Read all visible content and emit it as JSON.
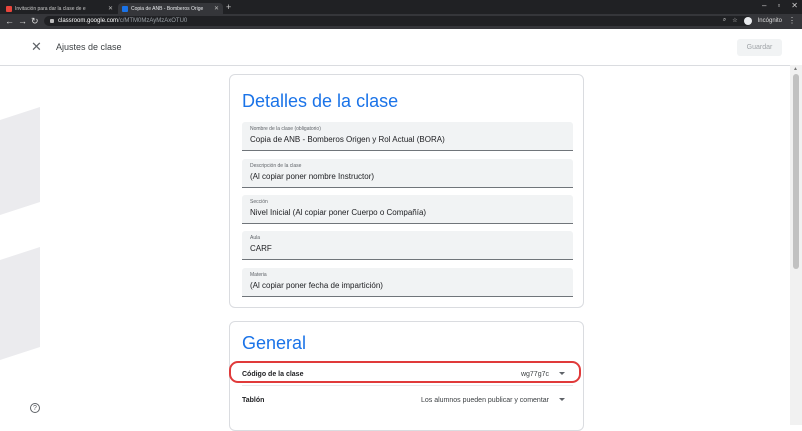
{
  "browser": {
    "tabs": [
      {
        "title": "Invitación para dar la clase de e",
        "favicon_color": "#e8453c"
      },
      {
        "title": "Copia de ANB - Bomberos Orige",
        "favicon_color": "#1a73e8"
      }
    ],
    "url_host": "classroom.google.com",
    "url_path": "/c/MTM0MzAyMzAxOTU0",
    "profile_label": "Incógnito"
  },
  "header": {
    "title": "Ajustes de clase",
    "save_label": "Guardar"
  },
  "details": {
    "heading": "Detalles de la clase",
    "fields": [
      {
        "label": "Nombre de la clase (obligatorio)",
        "value": "Copia de ANB - Bomberos Origen y Rol Actual (BORA)"
      },
      {
        "label": "Descripción de la clase",
        "value": "(Al copiar poner nombre Instructor)"
      },
      {
        "label": "Sección",
        "value": "Nivel Inicial (Al copiar poner Cuerpo o Compañía)"
      },
      {
        "label": "Aula",
        "value": "CARF"
      },
      {
        "label": "Materia",
        "value": "(Al copiar poner fecha de impartición)"
      }
    ]
  },
  "general": {
    "heading": "General",
    "class_code_label": "Código de la clase",
    "class_code_value": "wg77g7c",
    "board_label": "Tablón",
    "board_value": "Los alumnos pueden publicar y comentar"
  },
  "colors": {
    "accent": "#1a73e8",
    "highlight": "#e03a3a"
  }
}
